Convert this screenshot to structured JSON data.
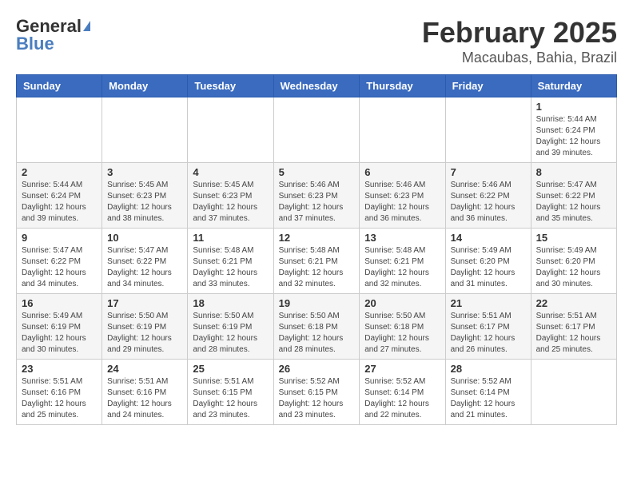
{
  "header": {
    "logo_general": "General",
    "logo_blue": "Blue",
    "month": "February 2025",
    "location": "Macaubas, Bahia, Brazil"
  },
  "days_of_week": [
    "Sunday",
    "Monday",
    "Tuesday",
    "Wednesday",
    "Thursday",
    "Friday",
    "Saturday"
  ],
  "weeks": [
    {
      "shaded": false,
      "days": [
        {
          "num": "",
          "info": ""
        },
        {
          "num": "",
          "info": ""
        },
        {
          "num": "",
          "info": ""
        },
        {
          "num": "",
          "info": ""
        },
        {
          "num": "",
          "info": ""
        },
        {
          "num": "",
          "info": ""
        },
        {
          "num": "1",
          "info": "Sunrise: 5:44 AM\nSunset: 6:24 PM\nDaylight: 12 hours and 39 minutes."
        }
      ]
    },
    {
      "shaded": true,
      "days": [
        {
          "num": "2",
          "info": "Sunrise: 5:44 AM\nSunset: 6:24 PM\nDaylight: 12 hours and 39 minutes."
        },
        {
          "num": "3",
          "info": "Sunrise: 5:45 AM\nSunset: 6:23 PM\nDaylight: 12 hours and 38 minutes."
        },
        {
          "num": "4",
          "info": "Sunrise: 5:45 AM\nSunset: 6:23 PM\nDaylight: 12 hours and 37 minutes."
        },
        {
          "num": "5",
          "info": "Sunrise: 5:46 AM\nSunset: 6:23 PM\nDaylight: 12 hours and 37 minutes."
        },
        {
          "num": "6",
          "info": "Sunrise: 5:46 AM\nSunset: 6:23 PM\nDaylight: 12 hours and 36 minutes."
        },
        {
          "num": "7",
          "info": "Sunrise: 5:46 AM\nSunset: 6:22 PM\nDaylight: 12 hours and 36 minutes."
        },
        {
          "num": "8",
          "info": "Sunrise: 5:47 AM\nSunset: 6:22 PM\nDaylight: 12 hours and 35 minutes."
        }
      ]
    },
    {
      "shaded": false,
      "days": [
        {
          "num": "9",
          "info": "Sunrise: 5:47 AM\nSunset: 6:22 PM\nDaylight: 12 hours and 34 minutes."
        },
        {
          "num": "10",
          "info": "Sunrise: 5:47 AM\nSunset: 6:22 PM\nDaylight: 12 hours and 34 minutes."
        },
        {
          "num": "11",
          "info": "Sunrise: 5:48 AM\nSunset: 6:21 PM\nDaylight: 12 hours and 33 minutes."
        },
        {
          "num": "12",
          "info": "Sunrise: 5:48 AM\nSunset: 6:21 PM\nDaylight: 12 hours and 32 minutes."
        },
        {
          "num": "13",
          "info": "Sunrise: 5:48 AM\nSunset: 6:21 PM\nDaylight: 12 hours and 32 minutes."
        },
        {
          "num": "14",
          "info": "Sunrise: 5:49 AM\nSunset: 6:20 PM\nDaylight: 12 hours and 31 minutes."
        },
        {
          "num": "15",
          "info": "Sunrise: 5:49 AM\nSunset: 6:20 PM\nDaylight: 12 hours and 30 minutes."
        }
      ]
    },
    {
      "shaded": true,
      "days": [
        {
          "num": "16",
          "info": "Sunrise: 5:49 AM\nSunset: 6:19 PM\nDaylight: 12 hours and 30 minutes."
        },
        {
          "num": "17",
          "info": "Sunrise: 5:50 AM\nSunset: 6:19 PM\nDaylight: 12 hours and 29 minutes."
        },
        {
          "num": "18",
          "info": "Sunrise: 5:50 AM\nSunset: 6:19 PM\nDaylight: 12 hours and 28 minutes."
        },
        {
          "num": "19",
          "info": "Sunrise: 5:50 AM\nSunset: 6:18 PM\nDaylight: 12 hours and 28 minutes."
        },
        {
          "num": "20",
          "info": "Sunrise: 5:50 AM\nSunset: 6:18 PM\nDaylight: 12 hours and 27 minutes."
        },
        {
          "num": "21",
          "info": "Sunrise: 5:51 AM\nSunset: 6:17 PM\nDaylight: 12 hours and 26 minutes."
        },
        {
          "num": "22",
          "info": "Sunrise: 5:51 AM\nSunset: 6:17 PM\nDaylight: 12 hours and 25 minutes."
        }
      ]
    },
    {
      "shaded": false,
      "days": [
        {
          "num": "23",
          "info": "Sunrise: 5:51 AM\nSunset: 6:16 PM\nDaylight: 12 hours and 25 minutes."
        },
        {
          "num": "24",
          "info": "Sunrise: 5:51 AM\nSunset: 6:16 PM\nDaylight: 12 hours and 24 minutes."
        },
        {
          "num": "25",
          "info": "Sunrise: 5:51 AM\nSunset: 6:15 PM\nDaylight: 12 hours and 23 minutes."
        },
        {
          "num": "26",
          "info": "Sunrise: 5:52 AM\nSunset: 6:15 PM\nDaylight: 12 hours and 23 minutes."
        },
        {
          "num": "27",
          "info": "Sunrise: 5:52 AM\nSunset: 6:14 PM\nDaylight: 12 hours and 22 minutes."
        },
        {
          "num": "28",
          "info": "Sunrise: 5:52 AM\nSunset: 6:14 PM\nDaylight: 12 hours and 21 minutes."
        },
        {
          "num": "",
          "info": ""
        }
      ]
    }
  ]
}
